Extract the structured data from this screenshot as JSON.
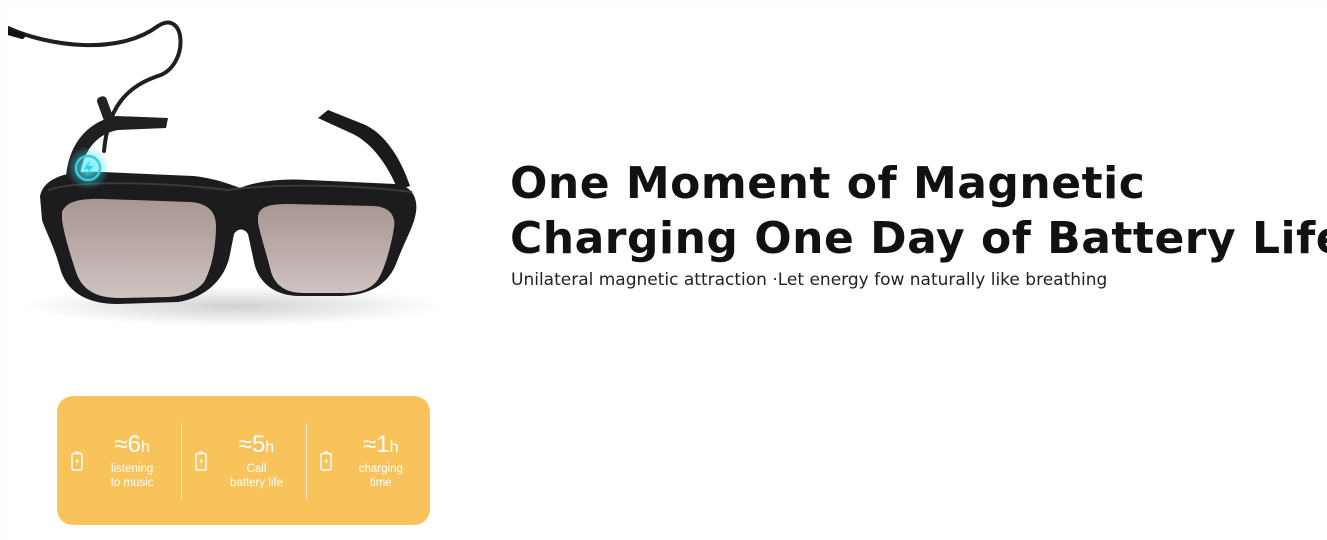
{
  "headline": {
    "line1": "One Moment of Magnetic",
    "line2": "Charging One Day of Battery Life"
  },
  "subheadline": "Unilateral magnetic attraction ·Let energy fow naturally like breathing",
  "stats": [
    {
      "value": "≈6",
      "unit": "h",
      "label_line1": "listening",
      "label_line2": "to music",
      "icon": "battery-icon"
    },
    {
      "value": "≈5",
      "unit": "h",
      "label_line1": "Call",
      "label_line2": "battery life",
      "icon": "battery-icon"
    },
    {
      "value": "≈1",
      "unit": "h",
      "label_line1": "charging",
      "label_line2": "time",
      "icon": "battery-icon"
    }
  ],
  "colors": {
    "accent": "#f9c35c",
    "headline_text": "#111111",
    "frame": "#1c1c1e",
    "lens": "#b3a39f",
    "charge_indicator": "#2fd1e0"
  }
}
